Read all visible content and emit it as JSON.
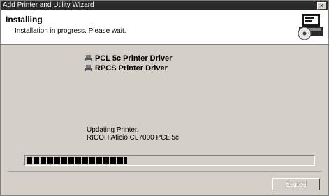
{
  "window": {
    "title": "Add Printer and Utility Wizard",
    "close_glyph": "×"
  },
  "header": {
    "heading": "Installing",
    "subheading": "Installation in progress. Please wait.",
    "icon": "printer-cd-icon"
  },
  "drivers": [
    {
      "label": "PCL 5c Printer Driver",
      "icon": "printer-driver-icon"
    },
    {
      "label": "RPCS Printer Driver",
      "icon": "printer-driver-icon"
    }
  ],
  "status": {
    "line1": "Updating Printer.",
    "line2": "RICOH Aficio CL7000 PCL 5c"
  },
  "progress": {
    "fraction": 0.35
  },
  "buttons": {
    "cancel_label": "Cancel",
    "cancel_enabled": false
  }
}
